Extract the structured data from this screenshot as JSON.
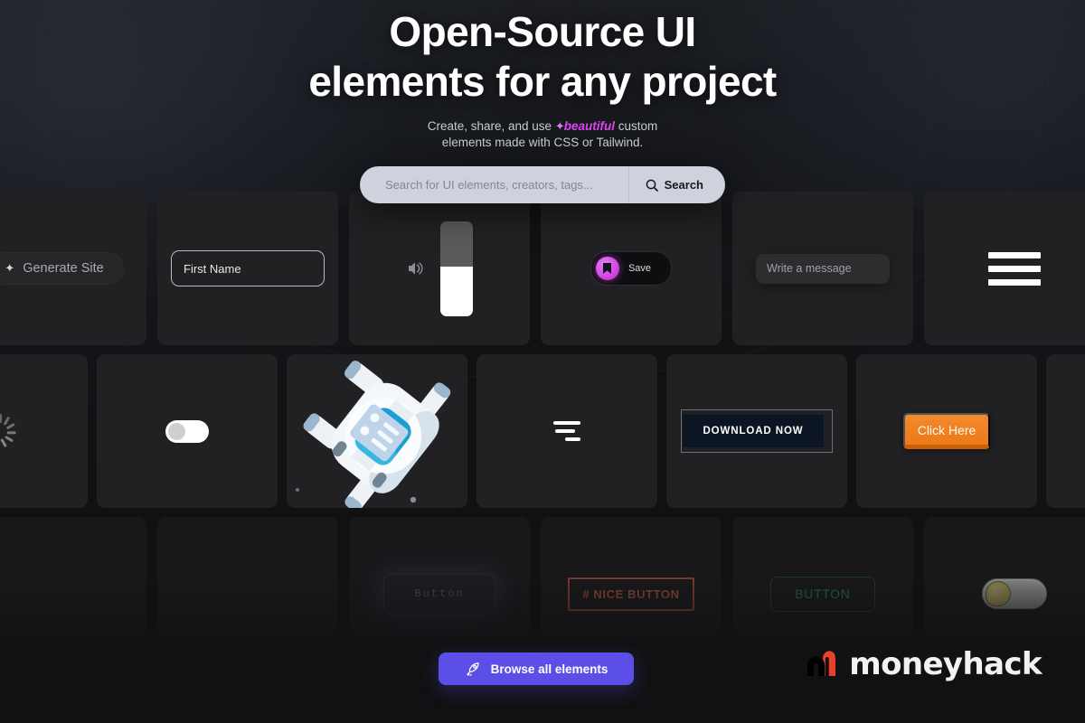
{
  "hero": {
    "title_line1": "Open-Source UI",
    "title_line2": "elements for any project",
    "subtitle_pre": "Create, share, and use ",
    "subtitle_sparkle": "✦",
    "subtitle_emphasis": "beautiful",
    "subtitle_post": " custom",
    "subtitle_line2": "elements made with CSS or Tailwind."
  },
  "search": {
    "placeholder": "Search for UI elements, creators, tags...",
    "value": "",
    "button_label": "Search",
    "icon": "search-icon"
  },
  "gallery": {
    "rows": [
      {
        "id": "row-1",
        "cards": [
          {
            "name": "generate-site-card",
            "label": "Generate Site",
            "icon": "sparkle-icon"
          },
          {
            "name": "first-name-input-card",
            "label": "First Name"
          },
          {
            "name": "volume-slider-card",
            "icon": "volume-icon",
            "fill_percent": 52
          },
          {
            "name": "save-toggle-card",
            "label": "Save",
            "icon": "bookmark-icon",
            "accent": "#d946ef"
          },
          {
            "name": "write-message-card",
            "label": "Write a message"
          },
          {
            "name": "hamburger-menu-card",
            "icon": "hamburger-icon"
          }
        ]
      },
      {
        "id": "row-2",
        "cards": [
          {
            "name": "spinner-loader-card",
            "icon": "spinner-icon"
          },
          {
            "name": "switch-toggle-card",
            "icon": "toggle-off-icon"
          },
          {
            "name": "astronaut-illustration-card",
            "icon": "astronaut-icon"
          },
          {
            "name": "bars-loader-card",
            "icon": "bars-loader-icon"
          },
          {
            "name": "download-now-card",
            "label": "DOWNLOAD NOW"
          },
          {
            "name": "click-here-card",
            "label": "Click Here",
            "accent": "#ed7a16"
          },
          {
            "name": "empty-card"
          }
        ]
      },
      {
        "id": "row-3",
        "cards": [
          {
            "name": "blank-card-1"
          },
          {
            "name": "blank-card-2"
          },
          {
            "name": "glow-button-card",
            "label": "Button"
          },
          {
            "name": "nice-button-card",
            "label": "# NICE BUTTON",
            "accent": "#b4543d"
          },
          {
            "name": "outline-button-card",
            "label": "BUTTON",
            "accent": "#2f8f6b"
          },
          {
            "name": "gold-toggle-card",
            "icon": "toggle-gold-icon"
          }
        ]
      }
    ]
  },
  "footer": {
    "browse_label": "Browse all elements",
    "browse_icon": "rocket-icon",
    "browse_color": "#5b4fe8",
    "brand_name": "moneyhack",
    "brand_mark_colors": [
      "#000000",
      "#e8412b"
    ]
  }
}
